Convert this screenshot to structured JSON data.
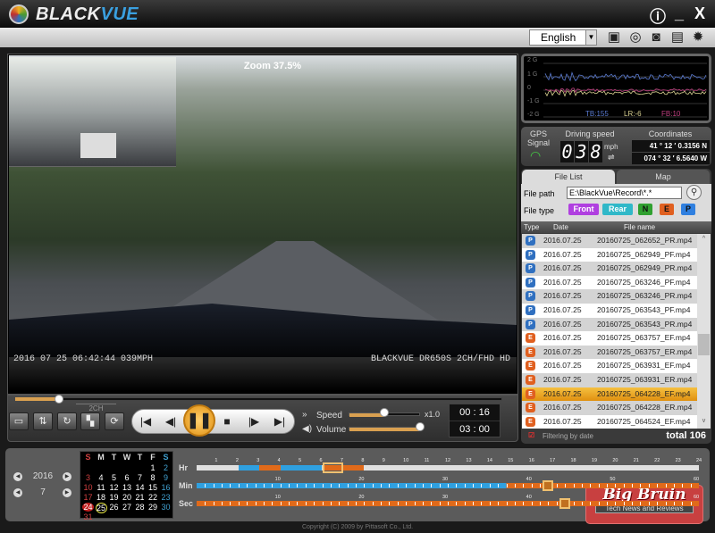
{
  "app": {
    "brand_a": "BLACK",
    "brand_b": "VUE",
    "info_icon": "info-icon",
    "minimize": "_",
    "close": "X"
  },
  "toolbar": {
    "language": "English",
    "icons": [
      "sd-card-refresh-icon",
      "compass-icon",
      "camera-icon",
      "print-icon",
      "gear-icon"
    ]
  },
  "video": {
    "zoom": "Zoom 37.5%",
    "osd_left": "2016 07 25 06:42:44   039MPH",
    "osd_right": "BLACKVUE DR650S 2CH/FHD HD"
  },
  "playback": {
    "seek_percent": 9,
    "ch_label": "2CH",
    "speed_label": "Speed",
    "speed_value": "x1.0",
    "speed_percent": 50,
    "volume_label": "Volume",
    "volume_percent": 100,
    "elapsed": "00 : 16",
    "total": "03 : 00"
  },
  "gsensor": {
    "axis": [
      "2 G",
      "1 G",
      "0",
      "-1 G",
      "-2 G"
    ],
    "tb": "TB:155",
    "lr": "LR:-6",
    "fb": "FB:10",
    "colors": {
      "tb": "#5a7ad0",
      "lr": "#d8d090",
      "fb": "#c04080"
    }
  },
  "gps": {
    "signal_l1": "GPS",
    "signal_l2": "Signal",
    "speed_label": "Driving speed",
    "speed_digits": [
      "0",
      "3",
      "8"
    ],
    "unit": "mph",
    "coord_label": "Coordinates",
    "lat": "41 °  12 ′  0.3156 N",
    "lon": "074 °  32 ′  6.5640 W"
  },
  "files": {
    "tab_list": "File List",
    "tab_map": "Map",
    "path_label": "File path",
    "path": "E:\\BlackVue\\Record\\*.*",
    "type_label": "File type",
    "types": [
      {
        "label": "Front",
        "color": "#b040e0"
      },
      {
        "label": "Rear",
        "color": "#30b8c8"
      },
      {
        "label": "N",
        "color": "#30a030"
      },
      {
        "label": "E",
        "color": "#e06020"
      },
      {
        "label": "P",
        "color": "#3080e0"
      }
    ],
    "columns": [
      "Type",
      "Date",
      "File name"
    ],
    "rows": [
      {
        "type": "P",
        "date": "2016.07.25",
        "name": "20160725_062652_PR.mp4"
      },
      {
        "type": "P",
        "date": "2016.07.25",
        "name": "20160725_062949_PF.mp4"
      },
      {
        "type": "P",
        "date": "2016.07.25",
        "name": "20160725_062949_PR.mp4"
      },
      {
        "type": "P",
        "date": "2016.07.25",
        "name": "20160725_063246_PF.mp4"
      },
      {
        "type": "P",
        "date": "2016.07.25",
        "name": "20160725_063246_PR.mp4"
      },
      {
        "type": "P",
        "date": "2016.07.25",
        "name": "20160725_063543_PF.mp4"
      },
      {
        "type": "P",
        "date": "2016.07.25",
        "name": "20160725_063543_PR.mp4"
      },
      {
        "type": "E",
        "date": "2016.07.25",
        "name": "20160725_063757_EF.mp4"
      },
      {
        "type": "E",
        "date": "2016.07.25",
        "name": "20160725_063757_ER.mp4"
      },
      {
        "type": "E",
        "date": "2016.07.25",
        "name": "20160725_063931_EF.mp4"
      },
      {
        "type": "E",
        "date": "2016.07.25",
        "name": "20160725_063931_ER.mp4"
      },
      {
        "type": "E",
        "date": "2016.07.25",
        "name": "20160725_064228_EF.mp4",
        "selected": true
      },
      {
        "type": "E",
        "date": "2016.07.25",
        "name": "20160725_064228_ER.mp4"
      },
      {
        "type": "E",
        "date": "2016.07.25",
        "name": "20160725_064524_EF.mp4"
      }
    ],
    "filter_label": "Filtering by date",
    "filter_checked": true,
    "total": "total 106"
  },
  "calendar": {
    "year": "2016",
    "month": "7",
    "weekdays": [
      "S",
      "M",
      "T",
      "W",
      "T",
      "F",
      "S"
    ],
    "first_weekday": 5,
    "days": 31,
    "event_day": 24,
    "selected_day": 25
  },
  "timeline": {
    "hr_label": "Hr",
    "min_label": "Min",
    "sec_label": "Sec",
    "hr_segments": [
      {
        "from": 0,
        "to": 2,
        "c": "#e0e0e0"
      },
      {
        "from": 2,
        "to": 3,
        "c": "#2fa0e0"
      },
      {
        "from": 3,
        "to": 4,
        "c": "#e06a1a"
      },
      {
        "from": 4,
        "to": 6,
        "c": "#2fa0e0"
      },
      {
        "from": 6,
        "to": 8,
        "c": "#e06a1a"
      },
      {
        "from": 8,
        "to": 24,
        "c": "#e0e0e0"
      }
    ],
    "hr_selected": 6,
    "min_blue_until": 37,
    "min_selected": 42,
    "sec_selected": 44,
    "min_ticks": [
      "10",
      "20",
      "30",
      "40",
      "50",
      "60"
    ]
  },
  "copyright": "Copyright (C) 2009 by Pittasoft Co., Ltd.",
  "watermark": {
    "title": "Big Bruin",
    "subtitle": "Tech News and Reviews"
  }
}
